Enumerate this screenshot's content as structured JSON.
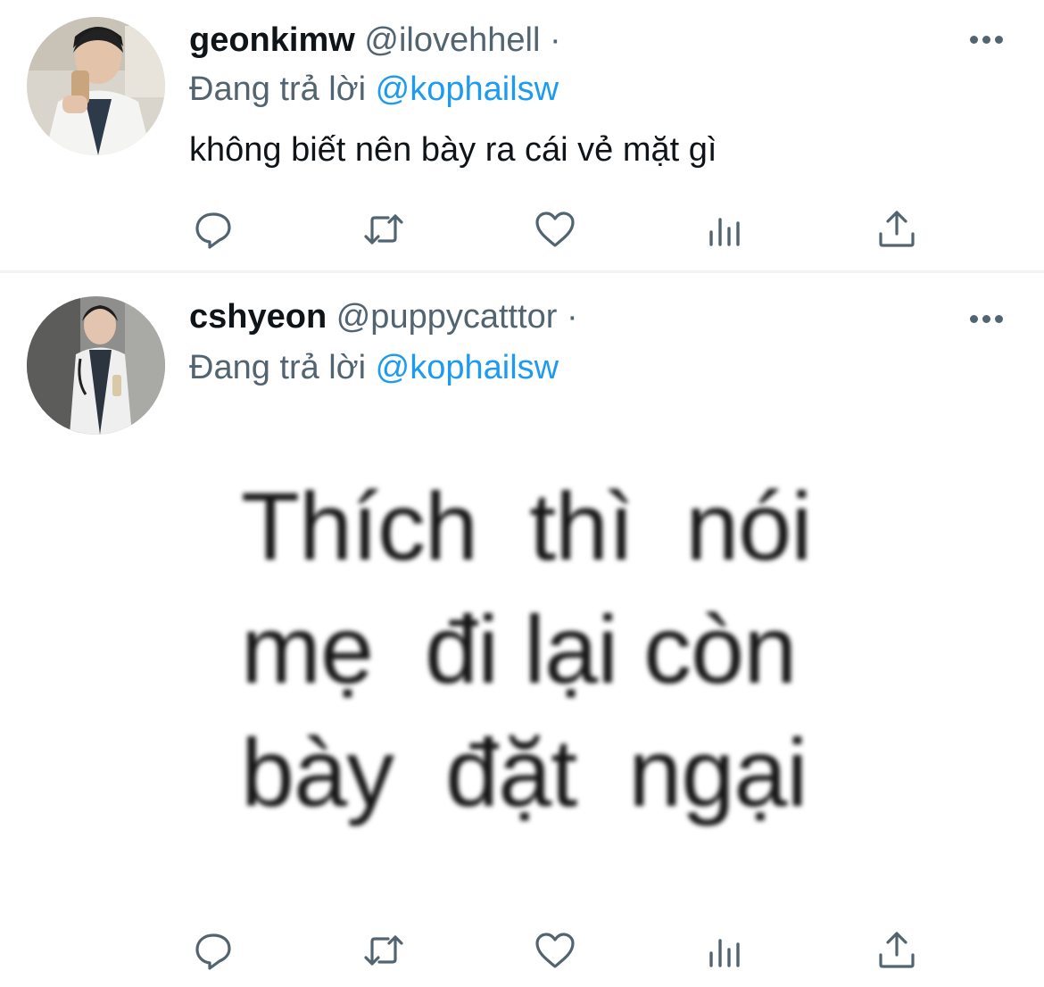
{
  "colors": {
    "text": "#0f1419",
    "secondary": "#536471",
    "accent": "#1d9bf0",
    "divider": "#eff3f4",
    "background": "#ffffff"
  },
  "tweets": [
    {
      "display_name": "geonkimw",
      "handle": "@ilovehhell",
      "separator": "·",
      "reply_prefix": "Đang trả lời",
      "reply_to": "@kophailsw",
      "text": "không biết nên bày ra cái vẻ mặt gì"
    },
    {
      "display_name": "cshyeon",
      "handle": "@puppycatttor",
      "separator": "·",
      "reply_prefix": "Đang trả lời",
      "reply_to": "@kophailsw",
      "image_text": [
        "Thích  thì  nói",
        "mẹ  đi lại còn",
        "bày  đặt  ngại"
      ]
    }
  ],
  "icons": {
    "reply": "reply-icon",
    "retweet": "retweet-icon",
    "like": "heart-icon",
    "views": "views-icon",
    "share": "share-icon",
    "more": "more-options-icon"
  }
}
